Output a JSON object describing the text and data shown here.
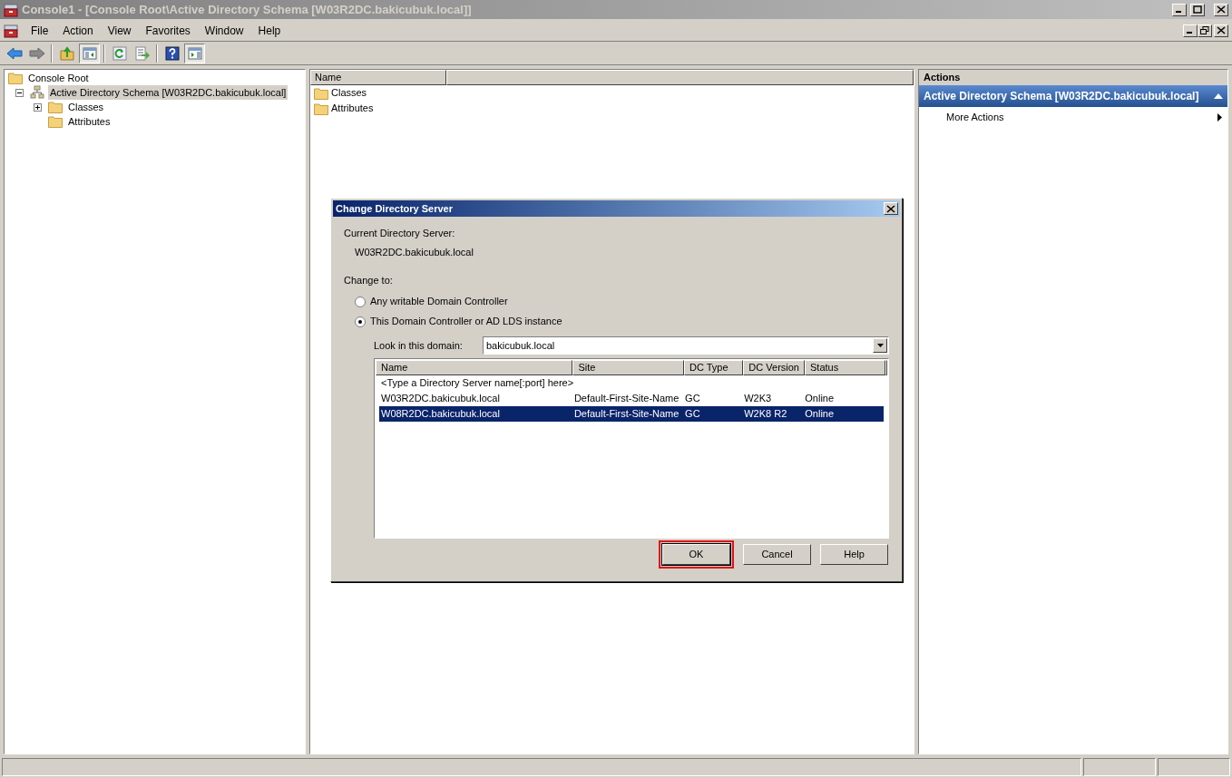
{
  "window": {
    "title": "Console1 - [Console Root\\Active Directory Schema [W03R2DC.bakicubuk.local]]"
  },
  "menu": [
    "File",
    "Action",
    "View",
    "Favorites",
    "Window",
    "Help"
  ],
  "toolbar": [
    {
      "kind": "back",
      "pressed": false
    },
    {
      "kind": "forward",
      "pressed": false
    },
    {
      "kind": "separator"
    },
    {
      "kind": "up",
      "pressed": false
    },
    {
      "kind": "tree",
      "pressed": true
    },
    {
      "kind": "separator"
    },
    {
      "kind": "refresh",
      "pressed": false
    },
    {
      "kind": "export",
      "pressed": false
    },
    {
      "kind": "separator"
    },
    {
      "kind": "help",
      "pressed": false
    },
    {
      "kind": "actionpane",
      "pressed": true
    }
  ],
  "tree": [
    {
      "label": "Console Root",
      "kind": "folder",
      "selected": false,
      "children": [
        {
          "label": "Active Directory Schema [W03R2DC.bakicubuk.local]",
          "kind": "snapin",
          "expanded": true,
          "selected": true,
          "children": [
            {
              "label": "Classes",
              "kind": "folder",
              "expanded": false,
              "selected": false
            },
            {
              "label": "Attributes",
              "kind": "folder",
              "selected": false
            }
          ]
        }
      ]
    }
  ],
  "list": {
    "column": "Name",
    "items": [
      "Classes",
      "Attributes"
    ]
  },
  "actions": {
    "title": "Actions",
    "section": "Active Directory Schema [W03R2DC.bakicubuk.local]",
    "items": [
      "More Actions"
    ]
  },
  "dialog": {
    "title": "Change Directory Server",
    "current_label": "Current Directory Server:",
    "current_value": "W03R2DC.bakicubuk.local",
    "change_label": "Change to:",
    "options": [
      {
        "label": "Any writable Domain Controller",
        "selected": false
      },
      {
        "label": "This Domain Controller or AD LDS instance",
        "selected": true
      }
    ],
    "domain_label": "Look in this domain:",
    "domain_value": "bakicubuk.local",
    "columns": [
      "Name",
      "Site",
      "DC Type",
      "DC Version",
      "Status"
    ],
    "rows": [
      {
        "kind": "prompt",
        "text": "<Type a Directory Server name[:port] here>",
        "selected": false
      },
      {
        "kind": "server",
        "cells": [
          "W03R2DC.bakicubuk.local",
          "Default-First-Site-Name",
          "GC",
          "W2K3",
          "Online"
        ],
        "selected": false
      },
      {
        "kind": "server",
        "cells": [
          "W08R2DC.bakicubuk.local",
          "Default-First-Site-Name",
          "GC",
          "W2K8 R2",
          "Online"
        ],
        "selected": true
      }
    ],
    "buttons": [
      {
        "label": "OK",
        "highlighted": true
      },
      {
        "label": "Cancel",
        "highlighted": false
      },
      {
        "label": "Help",
        "highlighted": false
      }
    ]
  }
}
